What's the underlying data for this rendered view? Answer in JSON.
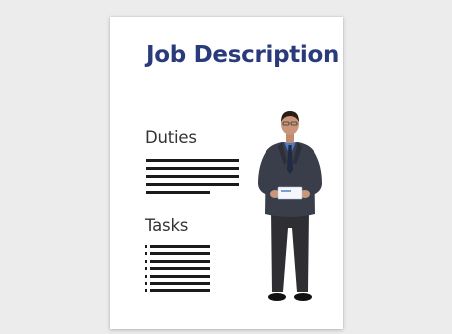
{
  "document": {
    "title": "Job Description",
    "sections": {
      "duties": "Duties",
      "tasks": "Tasks"
    }
  },
  "colors": {
    "background": "#ececec",
    "paper": "#ffffff",
    "title": "#2a3b7c",
    "text": "#333333",
    "lines": "#1a1a1a"
  },
  "figure": {
    "icon": "businessman-holding-card-icon"
  }
}
